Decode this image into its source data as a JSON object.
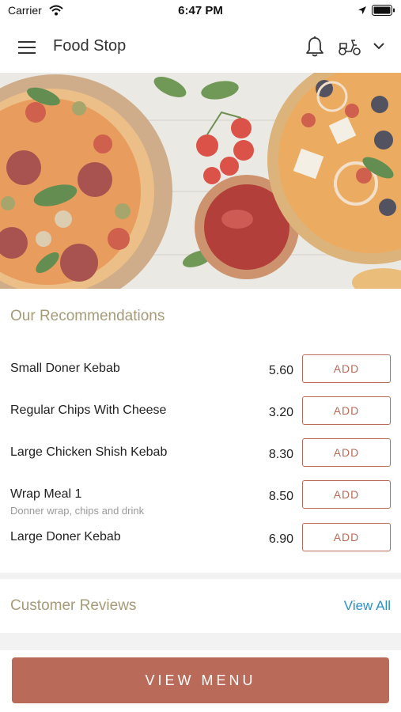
{
  "status_bar": {
    "carrier": "Carrier",
    "time": "6:47 PM"
  },
  "app_bar": {
    "title": "Food Stop",
    "icons": [
      "menu-icon",
      "bell-icon",
      "scooter-icon",
      "chevron-down-icon"
    ]
  },
  "recommendations": {
    "title": "Our Recommendations",
    "items": [
      {
        "name": "Small Doner Kebab",
        "description": "",
        "price": "5.60",
        "add_label": "ADD"
      },
      {
        "name": "Regular Chips With Cheese",
        "description": "",
        "price": "3.20",
        "add_label": "ADD"
      },
      {
        "name": "Large Chicken Shish Kebab",
        "description": "",
        "price": "8.30",
        "add_label": "ADD"
      },
      {
        "name": "Wrap Meal 1",
        "description": "Donner wrap, chips and drink",
        "price": "8.50",
        "add_label": "ADD"
      },
      {
        "name": "Large Doner Kebab",
        "description": "",
        "price": "6.90",
        "add_label": "ADD"
      }
    ]
  },
  "reviews": {
    "title": "Customer Reviews",
    "view_all_label": "View All"
  },
  "cta": {
    "view_menu_label": "VIEW MENU"
  },
  "colors": {
    "accent": "#b96a58",
    "section_title": "#a79a78",
    "link": "#2a8fc6",
    "band": "#f2f2f2"
  }
}
